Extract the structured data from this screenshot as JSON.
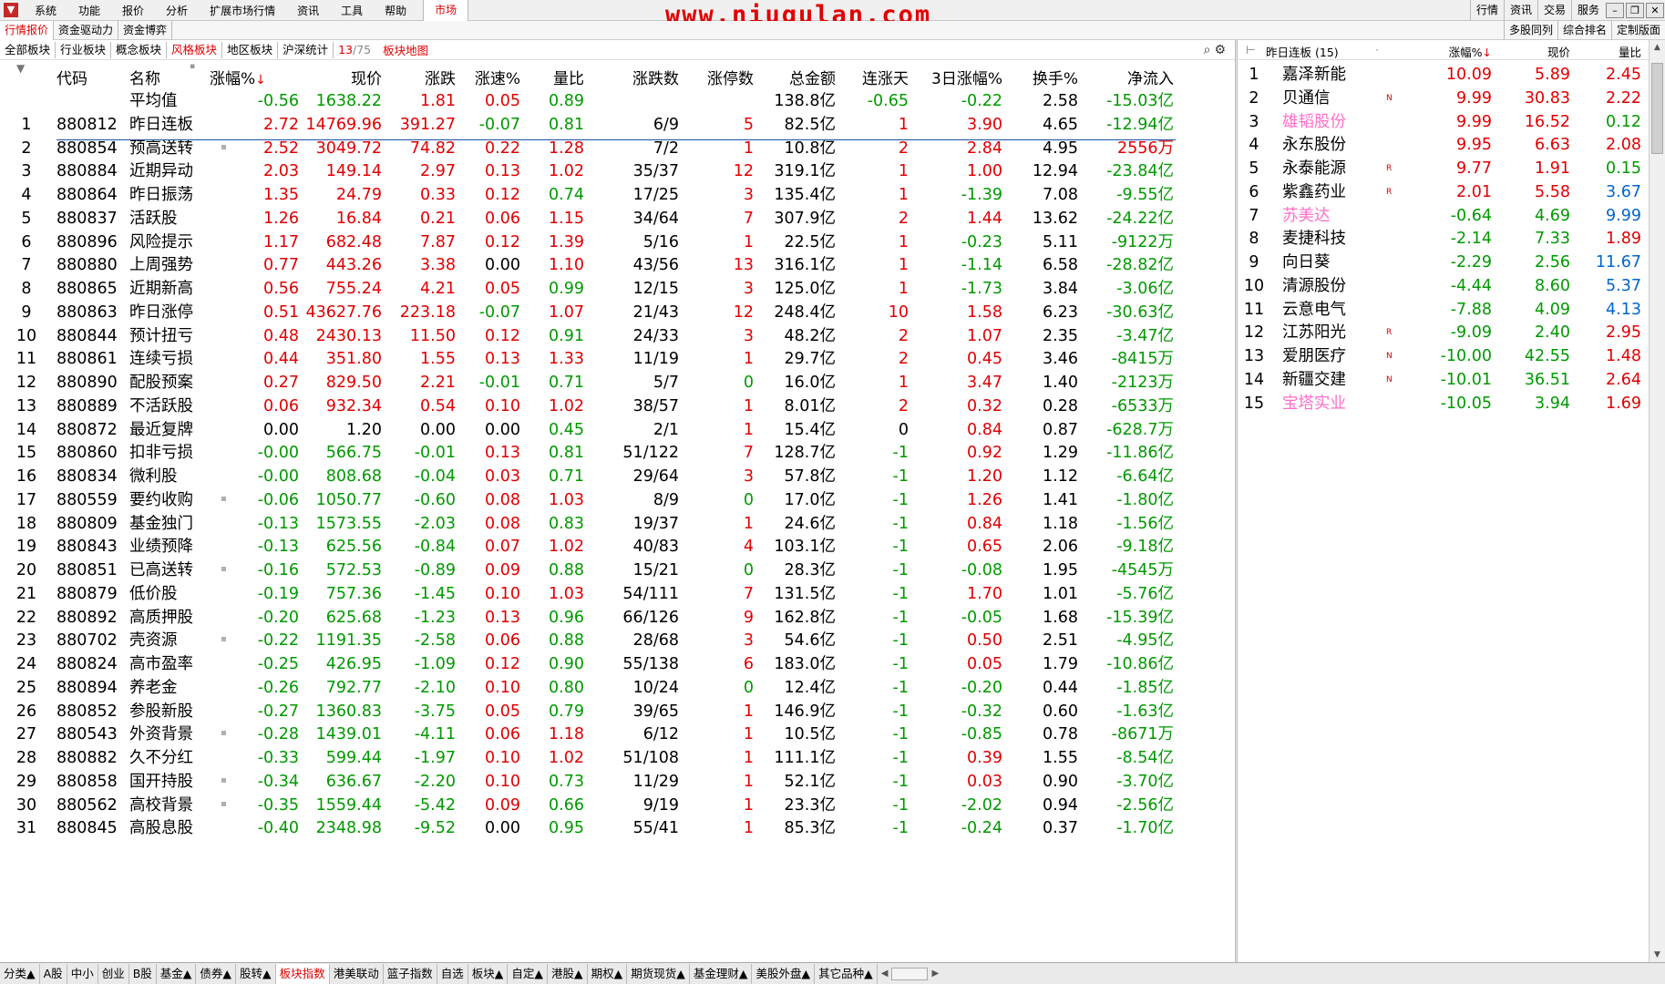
{
  "menubar": {
    "items": [
      "系统",
      "功能",
      "报价",
      "分析",
      "扩展市场行情",
      "资讯",
      "工具",
      "帮助"
    ],
    "active": "市场",
    "watermark": "www.niugulan.com",
    "right": [
      "行情",
      "资讯",
      "交易",
      "服务"
    ]
  },
  "tabs_row": {
    "left": [
      "行情报价",
      "资金驱动力",
      "资金博弈"
    ],
    "right": [
      "多股同列",
      "综合排名",
      "定制版面"
    ]
  },
  "sector_tabs": {
    "items": [
      "全部板块",
      "行业板块",
      "概念板块",
      "风格板块",
      "地区板块",
      "沪深统计"
    ],
    "active_index": 3,
    "page_current": "13",
    "page_total": "/75",
    "map": "板块地图"
  },
  "main_table": {
    "headers": {
      "code": "代码",
      "name": "名称",
      "chg": "涨幅%",
      "chg_sort": "↓",
      "price": "现价",
      "up": "涨跌",
      "speed": "涨速%",
      "vr": "量比",
      "updown": "涨跌数",
      "limit": "涨停数",
      "amount": "总金额",
      "lday": "连涨天",
      "chg3": "3日涨幅%",
      "turnover": "换手%",
      "netflow": "净流入"
    },
    "average": {
      "name": "平均值",
      "chg": "-0.56",
      "price": "1638.22",
      "up": "1.81",
      "speed": "0.05",
      "vr": "0.89",
      "amount": "138.8亿",
      "lday": "-0.65",
      "chg3": "-0.22",
      "turnover": "2.58",
      "netflow": "-15.03亿"
    },
    "rows": [
      {
        "idx": "1",
        "code": "880812",
        "name": "昨日连板",
        "dot": false,
        "chg": "2.72",
        "price": "14769.96",
        "up": "391.27",
        "speed": "-0.07",
        "vr": "0.81",
        "updown": "6/9",
        "limit": "5",
        "amount": "82.5亿",
        "lday": "1",
        "chg3": "3.90",
        "turnover": "4.65",
        "netflow": "-12.94亿"
      },
      {
        "idx": "2",
        "code": "880854",
        "name": "预高送转",
        "dot": true,
        "chg": "2.52",
        "price": "3049.72",
        "up": "74.82",
        "speed": "0.22",
        "vr": "1.28",
        "updown": "7/2",
        "limit": "1",
        "amount": "10.8亿",
        "lday": "2",
        "chg3": "2.84",
        "turnover": "4.95",
        "netflow": "2556万"
      },
      {
        "idx": "3",
        "code": "880884",
        "name": "近期异动",
        "dot": false,
        "chg": "2.03",
        "price": "149.14",
        "up": "2.97",
        "speed": "0.13",
        "vr": "1.02",
        "updown": "35/37",
        "limit": "12",
        "amount": "319.1亿",
        "lday": "1",
        "chg3": "1.00",
        "turnover": "12.94",
        "netflow": "-23.84亿"
      },
      {
        "idx": "4",
        "code": "880864",
        "name": "昨日振荡",
        "dot": false,
        "chg": "1.35",
        "price": "24.79",
        "up": "0.33",
        "speed": "0.12",
        "vr": "0.74",
        "updown": "17/25",
        "limit": "3",
        "amount": "135.4亿",
        "lday": "1",
        "chg3": "-1.39",
        "turnover": "7.08",
        "netflow": "-9.55亿"
      },
      {
        "idx": "5",
        "code": "880837",
        "name": "活跃股",
        "dot": false,
        "chg": "1.26",
        "price": "16.84",
        "up": "0.21",
        "speed": "0.06",
        "vr": "1.15",
        "updown": "34/64",
        "limit": "7",
        "amount": "307.9亿",
        "lday": "2",
        "chg3": "1.44",
        "turnover": "13.62",
        "netflow": "-24.22亿"
      },
      {
        "idx": "6",
        "code": "880896",
        "name": "风险提示",
        "dot": false,
        "chg": "1.17",
        "price": "682.48",
        "up": "7.87",
        "speed": "0.12",
        "vr": "1.39",
        "updown": "5/16",
        "limit": "1",
        "amount": "22.5亿",
        "lday": "1",
        "chg3": "-0.23",
        "turnover": "5.11",
        "netflow": "-9122万"
      },
      {
        "idx": "7",
        "code": "880880",
        "name": "上周强势",
        "dot": false,
        "chg": "0.77",
        "price": "443.26",
        "up": "3.38",
        "speed": "0.00",
        "vr": "1.10",
        "updown": "43/56",
        "limit": "13",
        "amount": "316.1亿",
        "lday": "1",
        "chg3": "-1.14",
        "turnover": "6.58",
        "netflow": "-28.82亿"
      },
      {
        "idx": "8",
        "code": "880865",
        "name": "近期新高",
        "dot": false,
        "chg": "0.56",
        "price": "755.24",
        "up": "4.21",
        "speed": "0.05",
        "vr": "0.99",
        "updown": "12/15",
        "limit": "3",
        "amount": "125.0亿",
        "lday": "1",
        "chg3": "-1.73",
        "turnover": "3.84",
        "netflow": "-3.06亿"
      },
      {
        "idx": "9",
        "code": "880863",
        "name": "昨日涨停",
        "dot": false,
        "chg": "0.51",
        "price": "43627.76",
        "up": "223.18",
        "speed": "-0.07",
        "vr": "1.07",
        "updown": "21/43",
        "limit": "12",
        "amount": "248.4亿",
        "lday": "10",
        "chg3": "1.58",
        "turnover": "6.23",
        "netflow": "-30.63亿"
      },
      {
        "idx": "10",
        "code": "880844",
        "name": "预计扭亏",
        "dot": false,
        "chg": "0.48",
        "price": "2430.13",
        "up": "11.50",
        "speed": "0.12",
        "vr": "0.91",
        "updown": "24/33",
        "limit": "3",
        "amount": "48.2亿",
        "lday": "2",
        "chg3": "1.07",
        "turnover": "2.35",
        "netflow": "-3.47亿"
      },
      {
        "idx": "11",
        "code": "880861",
        "name": "连续亏损",
        "dot": false,
        "chg": "0.44",
        "price": "351.80",
        "up": "1.55",
        "speed": "0.13",
        "vr": "1.33",
        "updown": "11/19",
        "limit": "1",
        "amount": "29.7亿",
        "lday": "2",
        "chg3": "0.45",
        "turnover": "3.46",
        "netflow": "-8415万"
      },
      {
        "idx": "12",
        "code": "880890",
        "name": "配股预案",
        "dot": false,
        "chg": "0.27",
        "price": "829.50",
        "up": "2.21",
        "speed": "-0.01",
        "vr": "0.71",
        "updown": "5/7",
        "limit": "0",
        "amount": "16.0亿",
        "lday": "1",
        "chg3": "3.47",
        "turnover": "1.40",
        "netflow": "-2123万"
      },
      {
        "idx": "13",
        "code": "880889",
        "name": "不活跃股",
        "dot": false,
        "chg": "0.06",
        "price": "932.34",
        "up": "0.54",
        "speed": "0.10",
        "vr": "1.02",
        "updown": "38/57",
        "limit": "1",
        "amount": "8.01亿",
        "lday": "2",
        "chg3": "0.32",
        "turnover": "0.28",
        "netflow": "-6533万"
      },
      {
        "idx": "14",
        "code": "880872",
        "name": "最近复牌",
        "dot": false,
        "chg": "0.00",
        "price": "1.20",
        "up": "0.00",
        "speed": "0.00",
        "vr": "0.45",
        "updown": "2/1",
        "limit": "1",
        "amount": "15.4亿",
        "lday": "0",
        "chg3": "0.84",
        "turnover": "0.87",
        "netflow": "-628.7万"
      },
      {
        "idx": "15",
        "code": "880860",
        "name": "扣非亏损",
        "dot": false,
        "chg": "-0.00",
        "price": "566.75",
        "up": "-0.01",
        "speed": "0.13",
        "vr": "0.81",
        "updown": "51/122",
        "limit": "7",
        "amount": "128.7亿",
        "lday": "-1",
        "chg3": "0.92",
        "turnover": "1.29",
        "netflow": "-11.86亿"
      },
      {
        "idx": "16",
        "code": "880834",
        "name": "微利股",
        "dot": false,
        "chg": "-0.00",
        "price": "808.68",
        "up": "-0.04",
        "speed": "0.03",
        "vr": "0.71",
        "updown": "29/64",
        "limit": "3",
        "amount": "57.8亿",
        "lday": "-1",
        "chg3": "1.20",
        "turnover": "1.12",
        "netflow": "-6.64亿"
      },
      {
        "idx": "17",
        "code": "880559",
        "name": "要约收购",
        "dot": true,
        "chg": "-0.06",
        "price": "1050.77",
        "up": "-0.60",
        "speed": "0.08",
        "vr": "1.03",
        "updown": "8/9",
        "limit": "0",
        "amount": "17.0亿",
        "lday": "-1",
        "chg3": "1.26",
        "turnover": "1.41",
        "netflow": "-1.80亿"
      },
      {
        "idx": "18",
        "code": "880809",
        "name": "基金独门",
        "dot": false,
        "chg": "-0.13",
        "price": "1573.55",
        "up": "-2.03",
        "speed": "0.08",
        "vr": "0.83",
        "updown": "19/37",
        "limit": "1",
        "amount": "24.6亿",
        "lday": "-1",
        "chg3": "0.84",
        "turnover": "1.18",
        "netflow": "-1.56亿"
      },
      {
        "idx": "19",
        "code": "880843",
        "name": "业绩预降",
        "dot": false,
        "chg": "-0.13",
        "price": "625.56",
        "up": "-0.84",
        "speed": "0.07",
        "vr": "1.02",
        "updown": "40/83",
        "limit": "4",
        "amount": "103.1亿",
        "lday": "-1",
        "chg3": "0.65",
        "turnover": "2.06",
        "netflow": "-9.18亿"
      },
      {
        "idx": "20",
        "code": "880851",
        "name": "已高送转",
        "dot": true,
        "chg": "-0.16",
        "price": "572.53",
        "up": "-0.89",
        "speed": "0.09",
        "vr": "0.88",
        "updown": "15/21",
        "limit": "0",
        "amount": "28.3亿",
        "lday": "-1",
        "chg3": "-0.08",
        "turnover": "1.95",
        "netflow": "-4545万"
      },
      {
        "idx": "21",
        "code": "880879",
        "name": "低价股",
        "dot": false,
        "chg": "-0.19",
        "price": "757.36",
        "up": "-1.45",
        "speed": "0.10",
        "vr": "1.03",
        "updown": "54/111",
        "limit": "7",
        "amount": "131.5亿",
        "lday": "-1",
        "chg3": "1.70",
        "turnover": "1.01",
        "netflow": "-5.76亿"
      },
      {
        "idx": "22",
        "code": "880892",
        "name": "高质押股",
        "dot": false,
        "chg": "-0.20",
        "price": "625.68",
        "up": "-1.23",
        "speed": "0.13",
        "vr": "0.96",
        "updown": "66/126",
        "limit": "9",
        "amount": "162.8亿",
        "lday": "-1",
        "chg3": "-0.05",
        "turnover": "1.68",
        "netflow": "-15.39亿"
      },
      {
        "idx": "23",
        "code": "880702",
        "name": "壳资源",
        "dot": true,
        "chg": "-0.22",
        "price": "1191.35",
        "up": "-2.58",
        "speed": "0.06",
        "vr": "0.88",
        "updown": "28/68",
        "limit": "3",
        "amount": "54.6亿",
        "lday": "-1",
        "chg3": "0.50",
        "turnover": "2.51",
        "netflow": "-4.95亿"
      },
      {
        "idx": "24",
        "code": "880824",
        "name": "高市盈率",
        "dot": false,
        "chg": "-0.25",
        "price": "426.95",
        "up": "-1.09",
        "speed": "0.12",
        "vr": "0.90",
        "updown": "55/138",
        "limit": "6",
        "amount": "183.0亿",
        "lday": "-1",
        "chg3": "0.05",
        "turnover": "1.79",
        "netflow": "-10.86亿"
      },
      {
        "idx": "25",
        "code": "880894",
        "name": "养老金",
        "dot": false,
        "chg": "-0.26",
        "price": "792.77",
        "up": "-2.10",
        "speed": "0.10",
        "vr": "0.80",
        "updown": "10/24",
        "limit": "0",
        "amount": "12.4亿",
        "lday": "-1",
        "chg3": "-0.20",
        "turnover": "0.44",
        "netflow": "-1.85亿"
      },
      {
        "idx": "26",
        "code": "880852",
        "name": "参股新股",
        "dot": false,
        "chg": "-0.27",
        "price": "1360.83",
        "up": "-3.75",
        "speed": "0.05",
        "vr": "0.79",
        "updown": "39/65",
        "limit": "1",
        "amount": "146.9亿",
        "lday": "-1",
        "chg3": "-0.32",
        "turnover": "0.60",
        "netflow": "-1.63亿"
      },
      {
        "idx": "27",
        "code": "880543",
        "name": "外资背景",
        "dot": true,
        "chg": "-0.28",
        "price": "1439.01",
        "up": "-4.11",
        "speed": "0.06",
        "vr": "1.18",
        "updown": "6/12",
        "limit": "1",
        "amount": "10.5亿",
        "lday": "-1",
        "chg3": "-0.85",
        "turnover": "0.78",
        "netflow": "-8671万"
      },
      {
        "idx": "28",
        "code": "880882",
        "name": "久不分红",
        "dot": false,
        "chg": "-0.33",
        "price": "599.44",
        "up": "-1.97",
        "speed": "0.10",
        "vr": "1.02",
        "updown": "51/108",
        "limit": "1",
        "amount": "111.1亿",
        "lday": "-1",
        "chg3": "0.39",
        "turnover": "1.55",
        "netflow": "-8.54亿"
      },
      {
        "idx": "29",
        "code": "880858",
        "name": "国开持股",
        "dot": true,
        "chg": "-0.34",
        "price": "636.67",
        "up": "-2.20",
        "speed": "0.10",
        "vr": "0.73",
        "updown": "11/29",
        "limit": "1",
        "amount": "52.1亿",
        "lday": "-1",
        "chg3": "0.03",
        "turnover": "0.90",
        "netflow": "-3.70亿"
      },
      {
        "idx": "30",
        "code": "880562",
        "name": "高校背景",
        "dot": true,
        "chg": "-0.35",
        "price": "1559.44",
        "up": "-5.42",
        "speed": "0.09",
        "vr": "0.66",
        "updown": "9/19",
        "limit": "1",
        "amount": "23.3亿",
        "lday": "-1",
        "chg3": "-2.02",
        "turnover": "0.94",
        "netflow": "-2.56亿"
      },
      {
        "idx": "31",
        "code": "880845",
        "name": "高股息股",
        "dot": false,
        "chg": "-0.40",
        "price": "2348.98",
        "up": "-9.52",
        "speed": "0.00",
        "vr": "0.95",
        "updown": "55/41",
        "limit": "1",
        "amount": "85.3亿",
        "lday": "-1",
        "chg3": "-0.24",
        "turnover": "0.37",
        "netflow": "-1.70亿"
      }
    ]
  },
  "side_panel": {
    "title": "昨日连板",
    "count": "(15)",
    "headers": {
      "chg": "涨幅%",
      "chg_sort": "↓",
      "price": "现价",
      "vr": "量比"
    },
    "rows": [
      {
        "idx": "1",
        "name": "嘉泽新能",
        "flag": "",
        "nameColor": "black",
        "chg": "10.09",
        "price": "5.89",
        "vr": "2.45",
        "vrColor": "red"
      },
      {
        "idx": "2",
        "name": "贝通信",
        "flag": "N",
        "nameColor": "black",
        "chg": "9.99",
        "price": "30.83",
        "vr": "2.22",
        "vrColor": "red"
      },
      {
        "idx": "3",
        "name": "雄韬股份",
        "flag": "",
        "nameColor": "pink",
        "chg": "9.99",
        "price": "16.52",
        "vr": "0.12",
        "vrColor": "green"
      },
      {
        "idx": "4",
        "name": "永东股份",
        "flag": "",
        "nameColor": "black",
        "chg": "9.95",
        "price": "6.63",
        "vr": "2.08",
        "vrColor": "red"
      },
      {
        "idx": "5",
        "name": "永泰能源",
        "flag": "R",
        "nameColor": "black",
        "chg": "9.77",
        "price": "1.91",
        "vr": "0.15",
        "vrColor": "green"
      },
      {
        "idx": "6",
        "name": "紫鑫药业",
        "flag": "R",
        "nameColor": "black",
        "chg": "2.01",
        "price": "5.58",
        "vr": "3.67",
        "vrColor": "blue"
      },
      {
        "idx": "7",
        "name": "苏美达",
        "flag": "",
        "nameColor": "pink",
        "chg": "-0.64",
        "price": "4.69",
        "vr": "9.99",
        "vrColor": "blue"
      },
      {
        "idx": "8",
        "name": "麦捷科技",
        "flag": "",
        "nameColor": "black",
        "chg": "-2.14",
        "price": "7.33",
        "vr": "1.89",
        "vrColor": "red"
      },
      {
        "idx": "9",
        "name": "向日葵",
        "flag": "",
        "nameColor": "black",
        "chg": "-2.29",
        "price": "2.56",
        "vr": "11.67",
        "vrColor": "blue"
      },
      {
        "idx": "10",
        "name": "清源股份",
        "flag": "",
        "nameColor": "black",
        "chg": "-4.44",
        "price": "8.60",
        "vr": "5.37",
        "vrColor": "blue"
      },
      {
        "idx": "11",
        "name": "云意电气",
        "flag": "",
        "nameColor": "black",
        "chg": "-7.88",
        "price": "4.09",
        "vr": "4.13",
        "vrColor": "blue"
      },
      {
        "idx": "12",
        "name": "江苏阳光",
        "flag": "R",
        "nameColor": "black",
        "chg": "-9.09",
        "price": "2.40",
        "vr": "2.95",
        "vrColor": "red"
      },
      {
        "idx": "13",
        "name": "爱朋医疗",
        "flag": "N",
        "nameColor": "black",
        "chg": "-10.00",
        "price": "42.55",
        "vr": "1.48",
        "vrColor": "red"
      },
      {
        "idx": "14",
        "name": "新疆交建",
        "flag": "N",
        "nameColor": "black",
        "chg": "-10.01",
        "price": "36.51",
        "vr": "2.64",
        "vrColor": "red"
      },
      {
        "idx": "15",
        "name": "宝塔实业",
        "flag": "",
        "nameColor": "pink",
        "chg": "-10.05",
        "price": "3.94",
        "vr": "1.69",
        "vrColor": "red"
      }
    ]
  },
  "bottom_tabs": {
    "items": [
      "分类▲",
      "A股",
      "中小",
      "创业",
      "B股",
      "基金▲",
      "债券▲",
      "股转▲",
      "板块指数",
      "港美联动",
      "篮子指数",
      "自选",
      "板块▲",
      "自定▲",
      "港股▲",
      "期权▲",
      "期货现货▲",
      "基金理财▲",
      "美股外盘▲",
      "其它品种▲"
    ],
    "active_index": 8
  },
  "colors": {
    "up": "#e00000",
    "down": "#009900",
    "blue": "#0066cc",
    "pink": "#ff6ec7"
  }
}
